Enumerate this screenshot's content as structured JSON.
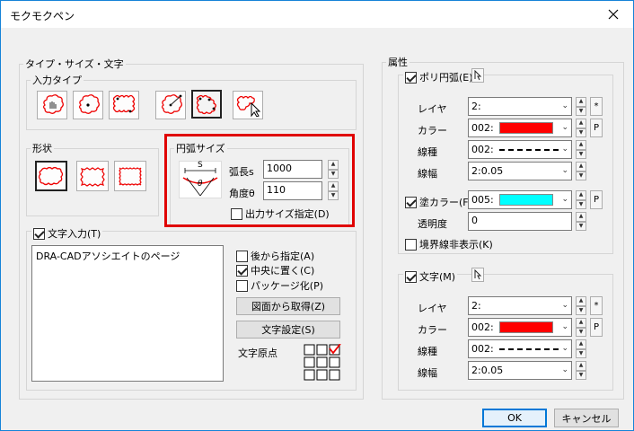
{
  "window": {
    "title": "モクモクペン"
  },
  "left": {
    "group_title": "タイプ・サイズ・文字",
    "input_type": {
      "title": "入力タイプ",
      "tools": [
        {
          "icon": "hand-cloud-icon"
        },
        {
          "icon": "center-point-cloud-icon"
        },
        {
          "icon": "rectangle-cloud-icon"
        },
        {
          "icon": "radius-cloud-icon"
        },
        {
          "icon": "polygon-cloud-icon"
        },
        {
          "icon": "cursor-cloud-icon"
        }
      ]
    },
    "shape": {
      "title": "形状",
      "options": [
        {
          "icon": "rounded-cloud-icon"
        },
        {
          "icon": "star-cloud-icon"
        },
        {
          "icon": "zigzag-cloud-icon"
        }
      ]
    },
    "arc_size": {
      "title": "円弧サイズ",
      "diagram_s": "S",
      "diagram_theta": "θ",
      "arc_length_label": "弧長s",
      "arc_length_value": "1000",
      "angle_label": "角度θ",
      "angle_value": "110",
      "output_size_label": "出力サイズ指定(D)",
      "output_size_checked": false
    },
    "text_input": {
      "label": "文字入力(T)",
      "checked": true,
      "text": "DRA-CADアソシエイトのページ",
      "options": [
        {
          "label": "後から指定(A)",
          "checked": false
        },
        {
          "label": "中央に置く(C)",
          "checked": true
        },
        {
          "label": "パッケージ化(P)",
          "checked": false
        }
      ],
      "get_from_drawing": "図面から取得(Z)",
      "text_settings": "文字設定(S)",
      "origin_label": "文字原点"
    }
  },
  "right": {
    "group_title": "属性",
    "polyarc": {
      "label": "ポリ円弧(E)",
      "checked": true,
      "layer_label": "レイヤ",
      "layer_value": "2:",
      "color_label": "カラー",
      "color_value": "002:",
      "color_swatch": "#ff0000",
      "linetype_label": "線種",
      "linetype_value": "002:",
      "linewidth_label": "線幅",
      "linewidth_value": "2:0.05",
      "fill_label": "塗カラー(F)",
      "fill_checked": true,
      "fill_value": "005:",
      "fill_swatch": "#00ffff",
      "opacity_label": "透明度",
      "opacity_value": "0",
      "hide_border_label": "境界線非表示(K)",
      "hide_border_checked": false
    },
    "text": {
      "label": "文字(M)",
      "checked": true,
      "layer_label": "レイヤ",
      "layer_value": "2:",
      "color_label": "カラー",
      "color_value": "002:",
      "color_swatch": "#ff0000",
      "linetype_label": "線種",
      "linetype_value": "002:",
      "linewidth_label": "線幅",
      "linewidth_value": "2:0.05"
    },
    "star_btn": "*",
    "p_btn": "P"
  },
  "footer": {
    "ok": "OK",
    "cancel": "キャンセル"
  }
}
